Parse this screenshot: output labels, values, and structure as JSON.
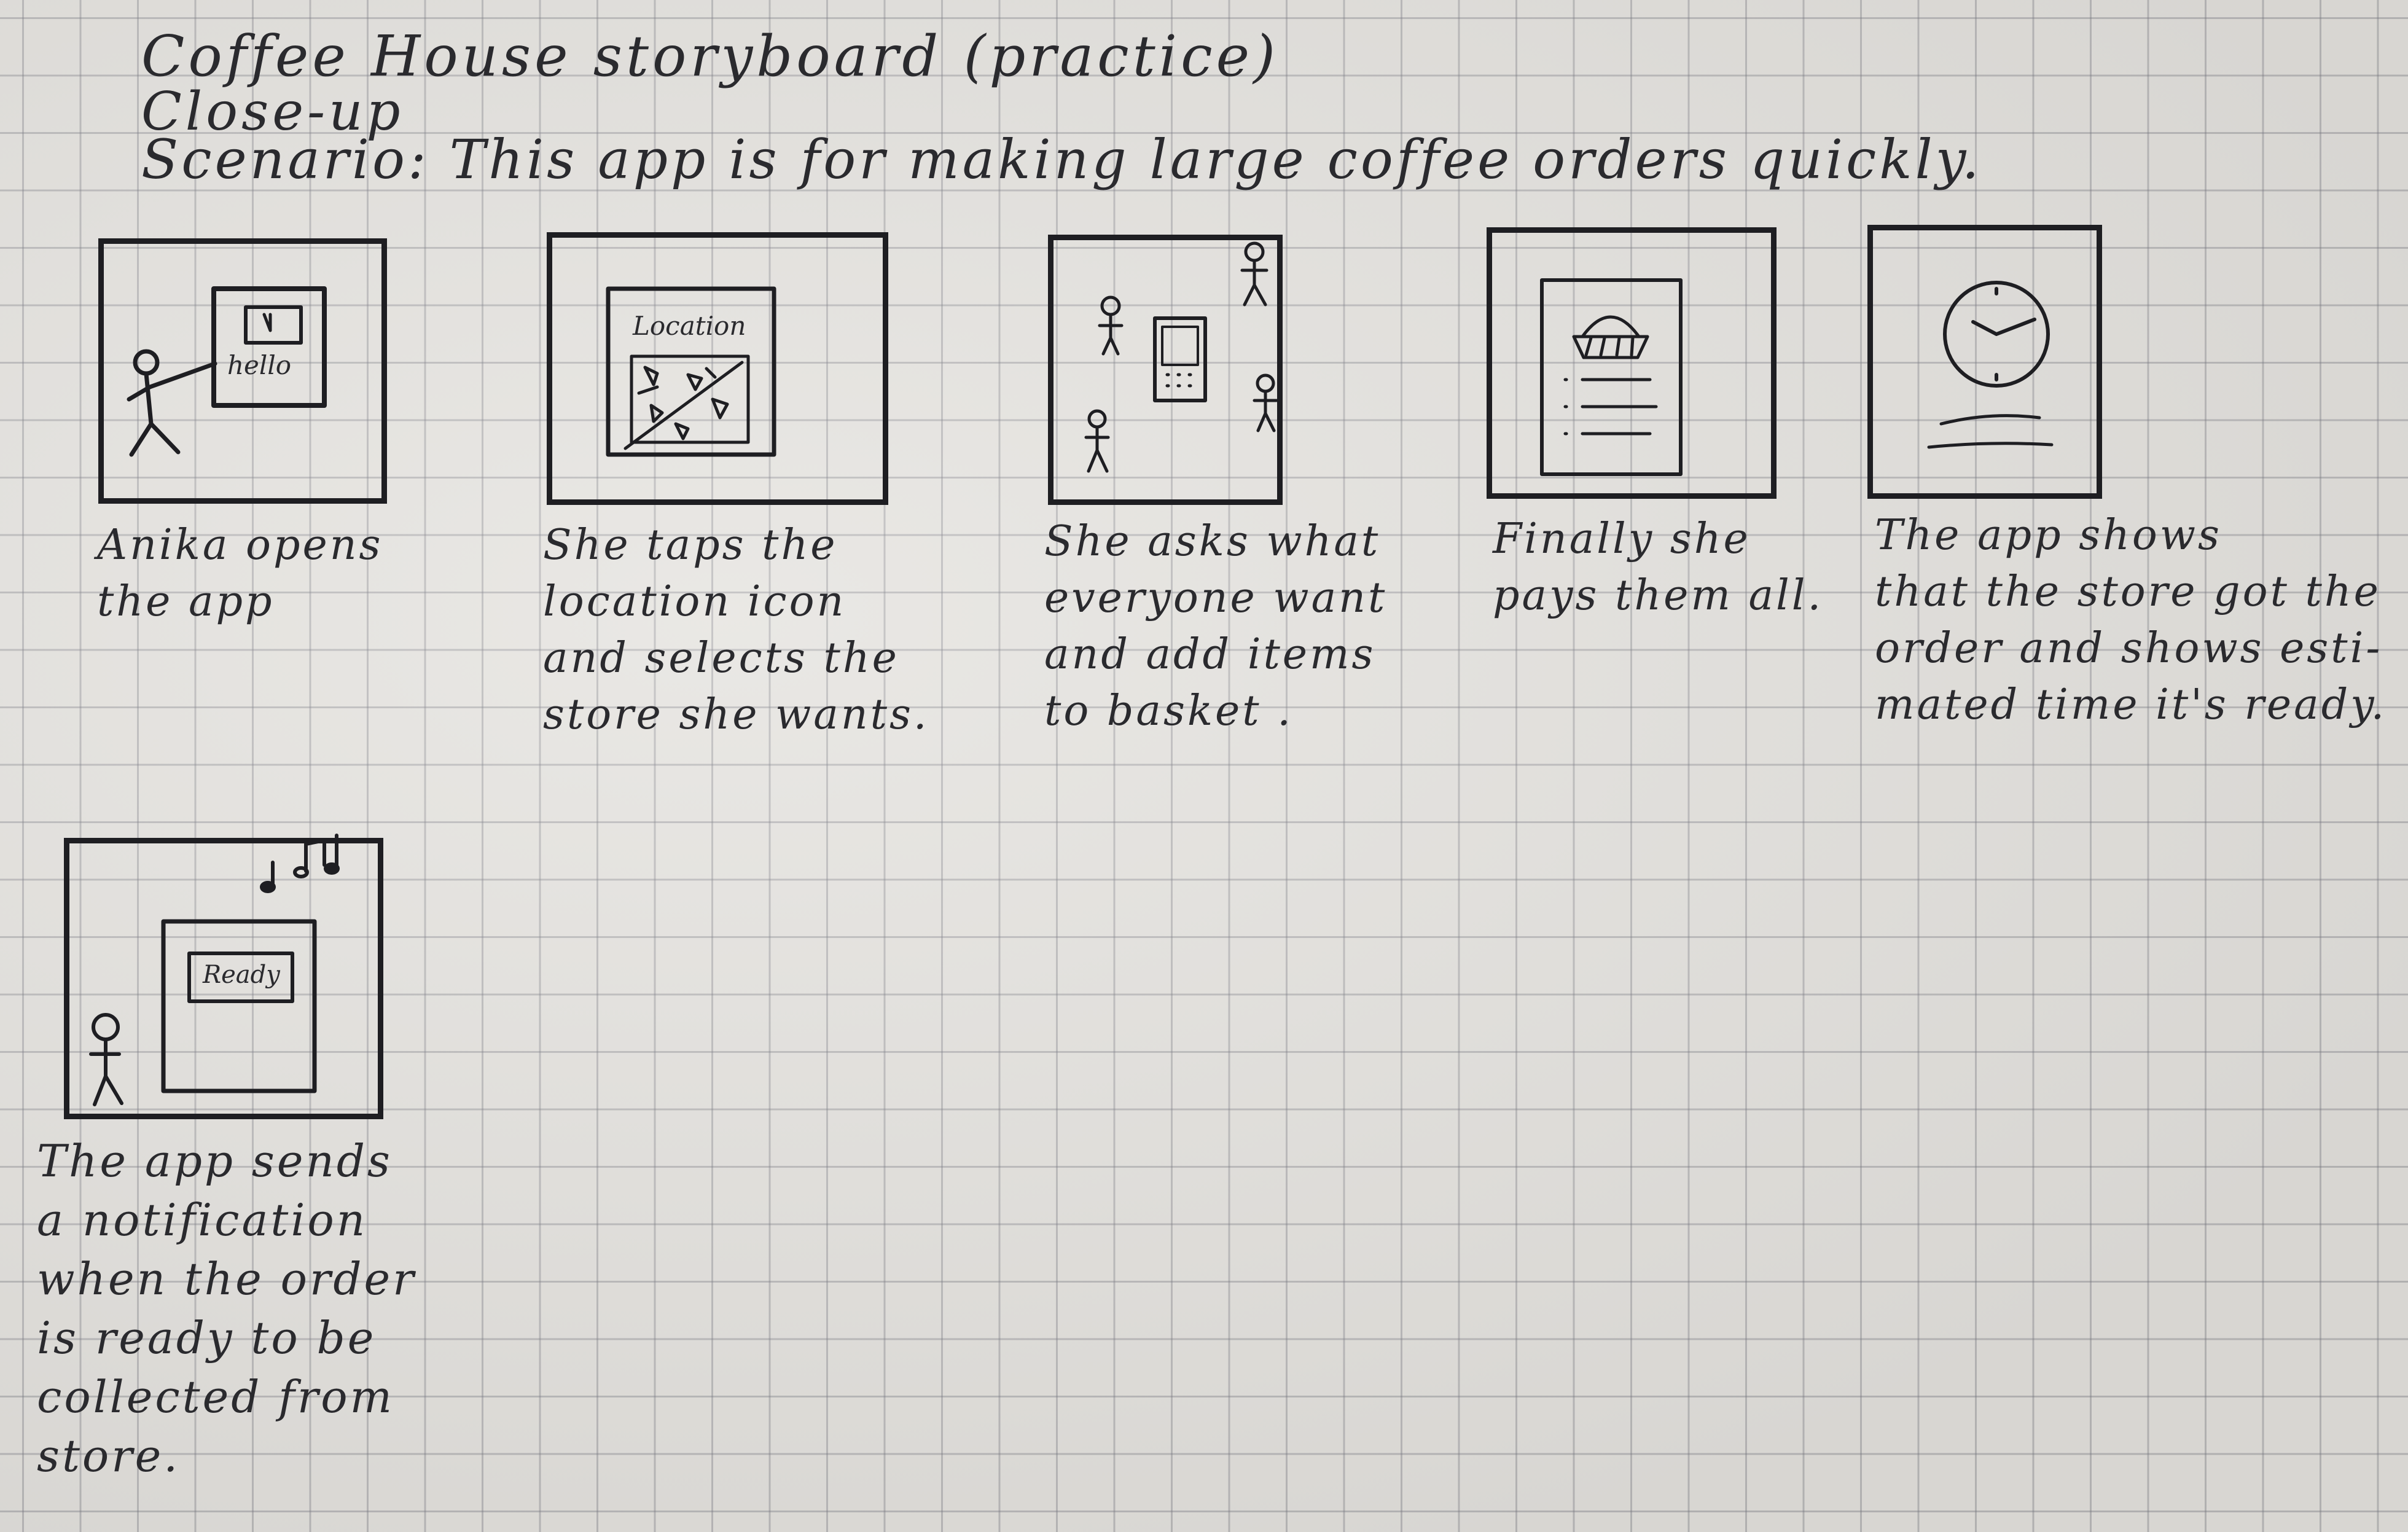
{
  "header": {
    "title": "Coffee House storyboard (practice)",
    "subtitle": "Close-up",
    "scenario": "Scenario: This app is for making large coffee orders quickly."
  },
  "panels": [
    {
      "sketch_text": "hello",
      "caption": "Anika opens\nthe app"
    },
    {
      "sketch_text": "Location",
      "caption": "She taps the\nlocation icon\nand selects the\nstore she wants."
    },
    {
      "caption": "She asks what\neveryone want\nand add items\nto basket ."
    },
    {
      "caption": "Finally she\npays them all."
    },
    {
      "caption": "The app shows\nthat the store got the\norder and shows esti-\nmated time it's ready."
    },
    {
      "sketch_text": "Ready",
      "caption": "The app sends\na notification\nwhen the order\nis ready to be\ncollected from\nstore."
    }
  ],
  "icons": [
    "stick-figure-icon",
    "map-icon",
    "basket-icon",
    "clock-icon",
    "music-notes-icon"
  ],
  "colors": {
    "paper": "#e5e3df",
    "grid": "#9a9aa2",
    "ink": "#1e1e22"
  }
}
